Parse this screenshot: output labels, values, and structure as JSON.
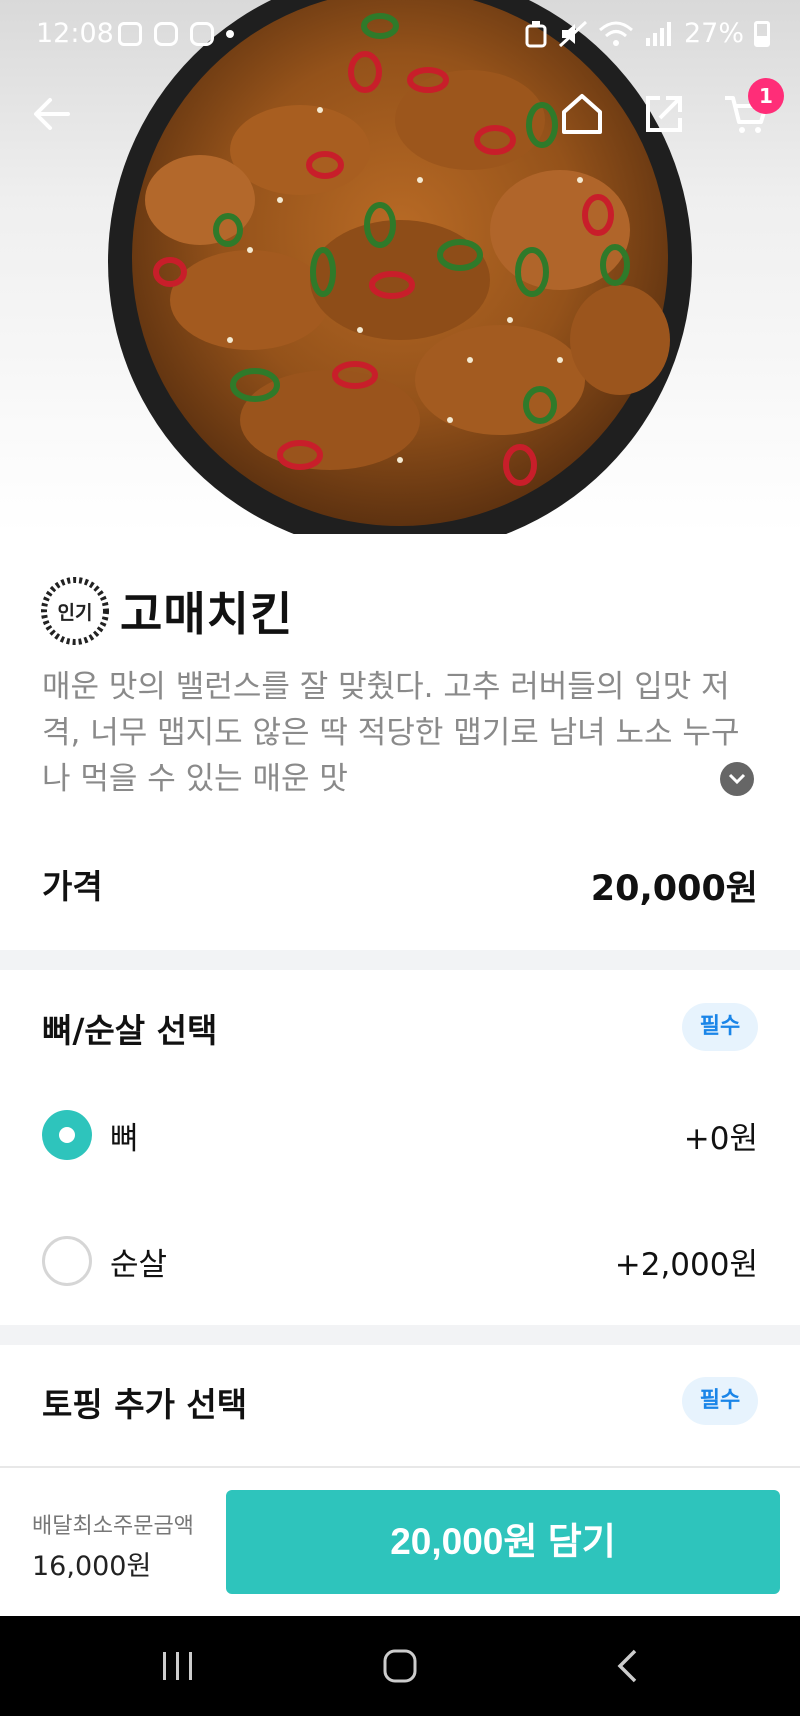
{
  "status_bar": {
    "time": "12:08",
    "battery": "27%",
    "icons": [
      "gallery-icon",
      "instagram-icon",
      "instagram-icon",
      "notification-dot",
      "recycle-icon",
      "mute-icon",
      "wifi-icon",
      "signal-icon",
      "battery-icon"
    ]
  },
  "header": {
    "cart_count": "1",
    "icons": [
      "back-arrow-icon",
      "home-icon",
      "share-icon",
      "cart-icon"
    ]
  },
  "product": {
    "badge": "인기",
    "name": "고매치킨",
    "description": "매운 맛의 밸런스를 잘 맞췄다. 고추 러버들의 입맛 저격, 너무 맵지도 않은 딱 적당한 맵기로 남녀 노소 누구나 먹을 수 있는 매운 맛",
    "price_label": "가격",
    "price": "20,000원"
  },
  "options": {
    "bone": {
      "title": "뼈/순살 선택",
      "required": "필수",
      "choices": [
        {
          "label": "뼈",
          "price": "+0원",
          "selected": true
        },
        {
          "label": "순살",
          "price": "+2,000원",
          "selected": false
        }
      ]
    },
    "topping": {
      "title": "토핑 추가 선택",
      "required": "필수"
    }
  },
  "footer": {
    "min_order_label": "배달최소주문금액",
    "min_order_value": "16,000원",
    "add_button": "20,000원 담기"
  },
  "colors": {
    "accent": "#2ec4bc",
    "badge_pink": "#ff2d78",
    "required_text": "#1a85e8",
    "required_bg": "#e7f3fd"
  }
}
